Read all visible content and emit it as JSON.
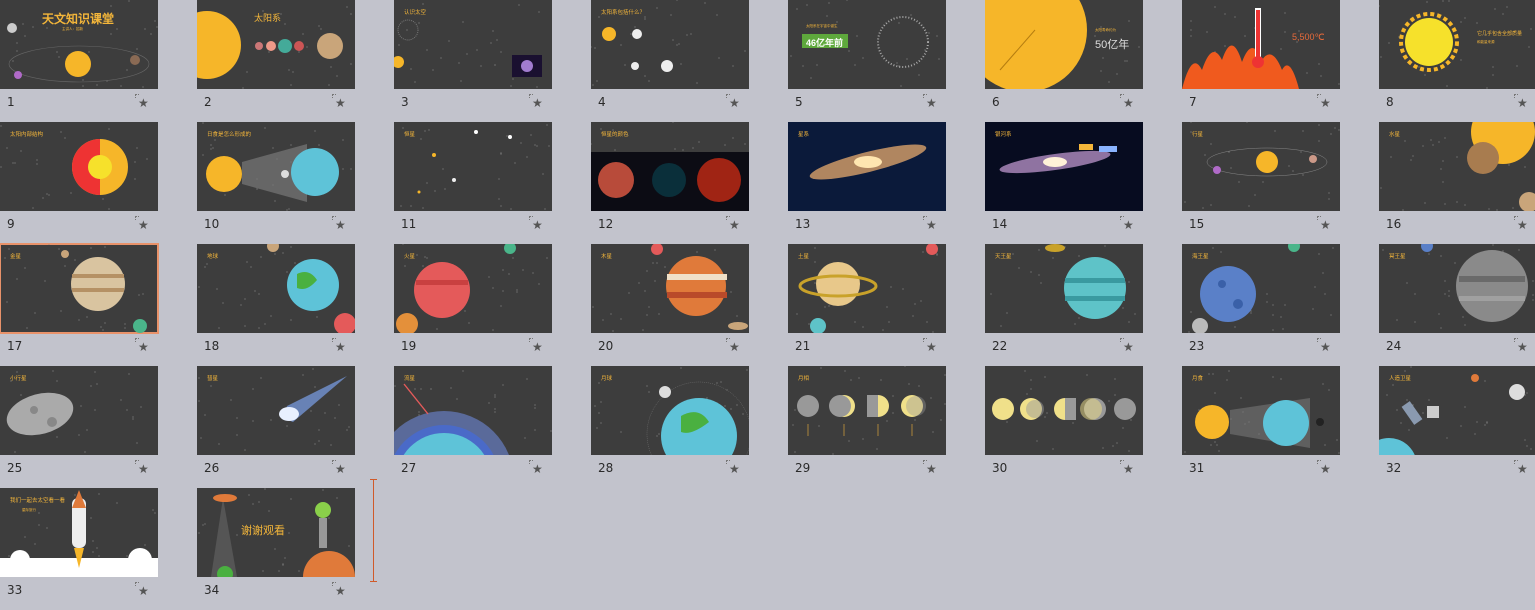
{
  "colors": {
    "background": "#c2c3cc",
    "slide": "#3d3d3d",
    "accent": "#f4b63a",
    "selection": "#e8926a"
  },
  "slides": [
    {
      "number": "1",
      "title": "天文知识课堂",
      "subtitle": "主讲人：招新"
    },
    {
      "number": "2",
      "title": "太阳系",
      "subtitle": ""
    },
    {
      "number": "3",
      "title": "认识太空",
      "subtitle": ""
    },
    {
      "number": "4",
      "title": "太阳系包括什么？",
      "subtitle": ""
    },
    {
      "number": "5",
      "title": "46亿年前",
      "subtitle": "太阳系在宇宙中诞生"
    },
    {
      "number": "6",
      "title": "50亿年",
      "subtitle": "太阳寿命约为"
    },
    {
      "number": "7",
      "title": "5,500℃",
      "subtitle": ""
    },
    {
      "number": "8",
      "title": "它几乎包含全部质量",
      "subtitle": "和能量来源"
    },
    {
      "number": "9",
      "title": "太阳内部结构",
      "subtitle": ""
    },
    {
      "number": "10",
      "title": "日食是怎么形成的",
      "subtitle": ""
    },
    {
      "number": "11",
      "title": "恒星",
      "subtitle": ""
    },
    {
      "number": "12",
      "title": "恒星的颜色",
      "subtitle": ""
    },
    {
      "number": "13",
      "title": "星系",
      "subtitle": ""
    },
    {
      "number": "14",
      "title": "银河系",
      "subtitle": ""
    },
    {
      "number": "15",
      "title": "行星",
      "subtitle": ""
    },
    {
      "number": "16",
      "title": "水星",
      "subtitle": ""
    },
    {
      "number": "17",
      "title": "金星",
      "subtitle": "",
      "selected": true
    },
    {
      "number": "18",
      "title": "地球",
      "subtitle": ""
    },
    {
      "number": "19",
      "title": "火星",
      "subtitle": ""
    },
    {
      "number": "20",
      "title": "木星",
      "subtitle": ""
    },
    {
      "number": "21",
      "title": "土星",
      "subtitle": ""
    },
    {
      "number": "22",
      "title": "天王星",
      "subtitle": ""
    },
    {
      "number": "23",
      "title": "海王星",
      "subtitle": ""
    },
    {
      "number": "24",
      "title": "冥王星",
      "subtitle": ""
    },
    {
      "number": "25",
      "title": "小行星",
      "subtitle": ""
    },
    {
      "number": "26",
      "title": "彗星",
      "subtitle": ""
    },
    {
      "number": "27",
      "title": "流星",
      "subtitle": ""
    },
    {
      "number": "28",
      "title": "月球",
      "subtitle": ""
    },
    {
      "number": "29",
      "title": "月相",
      "subtitle": ""
    },
    {
      "number": "30",
      "title": "",
      "subtitle": ""
    },
    {
      "number": "31",
      "title": "月食",
      "subtitle": ""
    },
    {
      "number": "32",
      "title": "人造卫星",
      "subtitle": ""
    },
    {
      "number": "33",
      "title": "我们一起去太空看一看",
      "subtitle": "星际旅行"
    },
    {
      "number": "34",
      "title": "谢谢观看",
      "subtitle": ""
    }
  ],
  "star_icon": "★"
}
